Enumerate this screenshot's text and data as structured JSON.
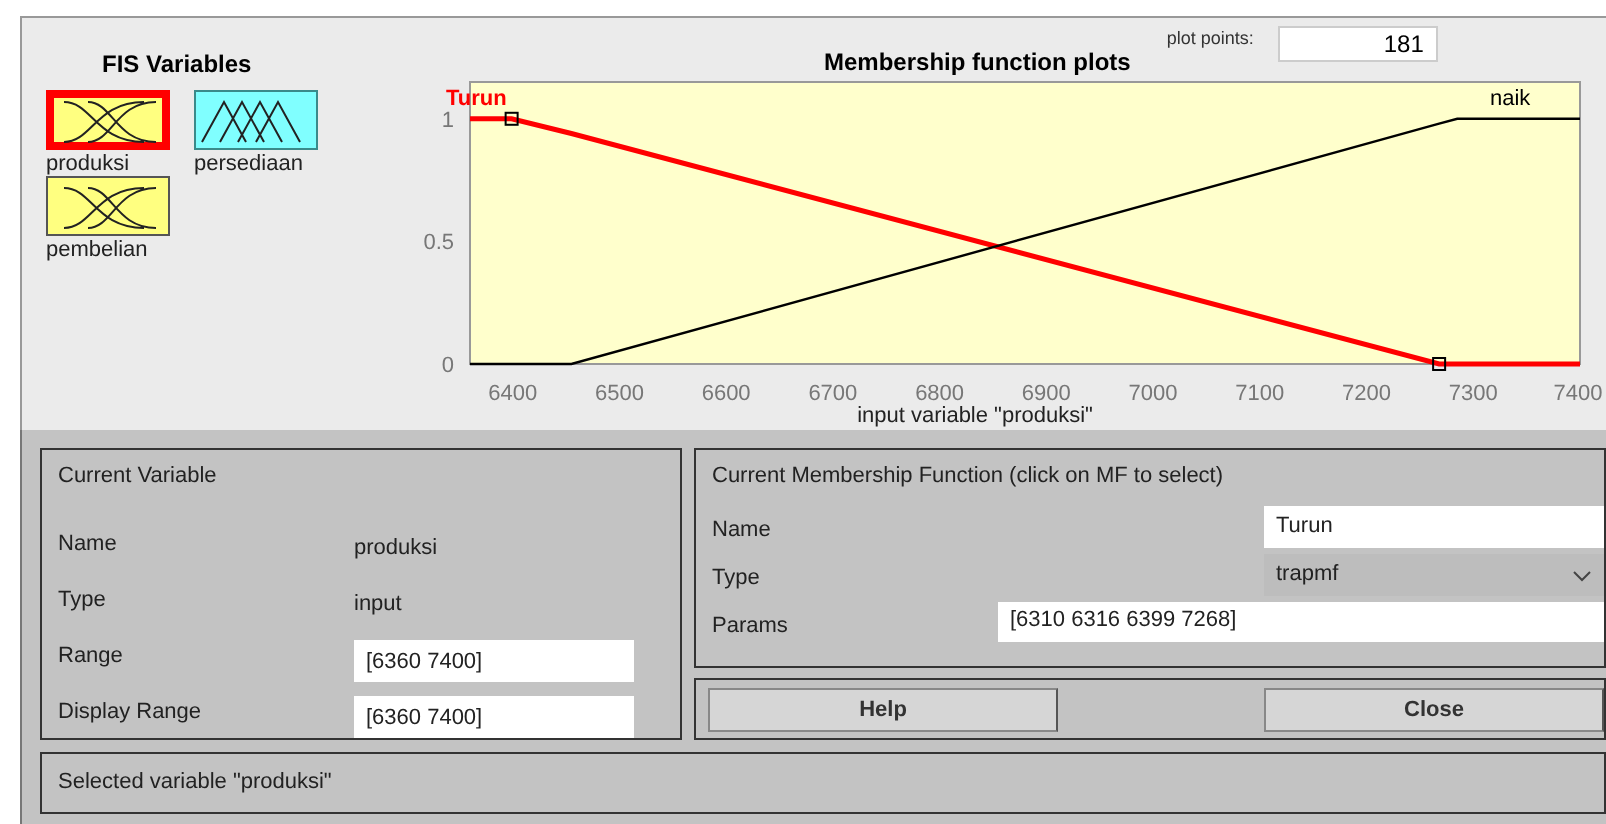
{
  "fis_variables": {
    "title": "FIS Variables",
    "items": [
      {
        "name": "produksi",
        "kind": "input",
        "selected": true
      },
      {
        "name": "persediaan",
        "kind": "output",
        "selected": false
      },
      {
        "name": "pembelian",
        "kind": "input",
        "selected": false
      }
    ]
  },
  "plot": {
    "curves": [
      {
        "selected": true
      },
      {
        "selected": false
      }
    ],
    "plot_points_label": "plot points:",
    "plot_points": "181",
    "chart_data": {
      "type": "line",
      "title": "Membership function plots",
      "xlabel": "input variable \"produksi\"",
      "x": [
        6360,
        6399,
        6455,
        7268,
        7285,
        7400
      ],
      "series": [
        {
          "name": "Turun",
          "color": "#ff0000",
          "values": [
            1,
            1,
            0.94,
            0,
            0,
            0
          ]
        },
        {
          "name": "naik",
          "color": "#000000",
          "values": [
            0,
            0,
            0,
            0.98,
            1,
            1
          ]
        }
      ],
      "xlim": [
        6360,
        7400
      ],
      "ylim": [
        0,
        1.15
      ],
      "xticks": [
        6400,
        6500,
        6600,
        6700,
        6800,
        6900,
        7000,
        7100,
        7200,
        7300,
        7400
      ],
      "yticks": [
        0,
        0.5,
        1
      ]
    }
  },
  "current_variable": {
    "title": "Current Variable",
    "name_label": "Name",
    "name": "produksi",
    "type_label": "Type",
    "type": "input",
    "range_label": "Range",
    "range": "[6360 7400]",
    "display_range_label": "Display Range",
    "display_range": "[6360 7400]"
  },
  "current_mf": {
    "title": "Current Membership Function (click on MF to select)",
    "name_label": "Name",
    "name": "Turun",
    "type_label": "Type",
    "type": "trapmf",
    "params_label": "Params",
    "params": "[6310 6316 6399 7268]"
  },
  "buttons": [
    "Help",
    "Close"
  ],
  "status_bar": "Selected variable \"produksi\""
}
